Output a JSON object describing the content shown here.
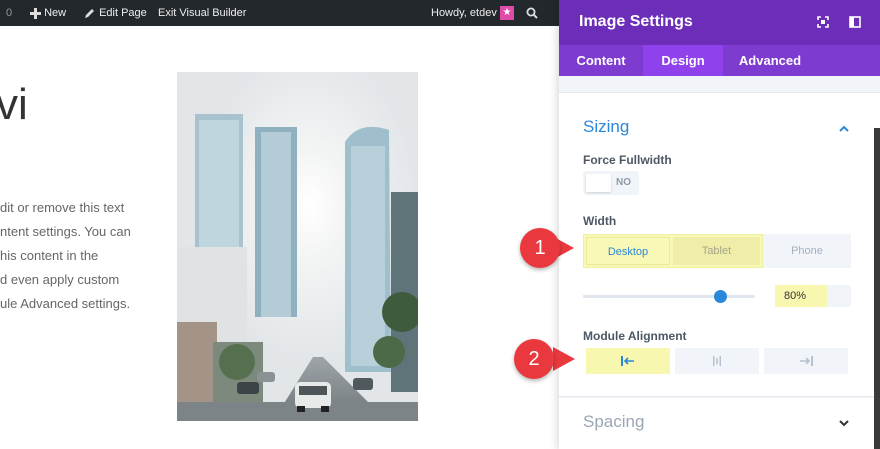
{
  "adminbar": {
    "count": "0",
    "new_label": "New",
    "edit_page": "Edit Page",
    "exit_builder": "Exit Visual Builder",
    "greeting": "Howdy, etdev"
  },
  "page": {
    "heading_fragment": "vi",
    "paragraph_lines": [
      "dit or remove this text",
      "ntent settings. You can",
      "his content in the",
      "d even apply custom",
      "ule Advanced settings."
    ]
  },
  "panel": {
    "title": "Image Settings",
    "tabs": [
      "Content",
      "Design",
      "Advanced"
    ],
    "active_tab": "Design",
    "sizing": {
      "title": "Sizing",
      "force_fullwidth": {
        "label": "Force Fullwidth",
        "value": "NO"
      },
      "width": {
        "label": "Width",
        "devices": [
          "Desktop",
          "Tablet",
          "Phone"
        ],
        "active": "Desktop",
        "value": "80%",
        "slider_fraction": 0.8
      },
      "module_alignment": {
        "label": "Module Alignment",
        "options": [
          "left",
          "center",
          "right"
        ],
        "selected": "left"
      }
    },
    "spacing": {
      "title": "Spacing"
    }
  },
  "callouts": [
    "1",
    "2"
  ],
  "colors": {
    "accent": "#2b87da",
    "header": "#6c2eb9",
    "tabs": "#7e3bd0",
    "highlight": "#f8f7b0",
    "callout": "#e9393e"
  }
}
